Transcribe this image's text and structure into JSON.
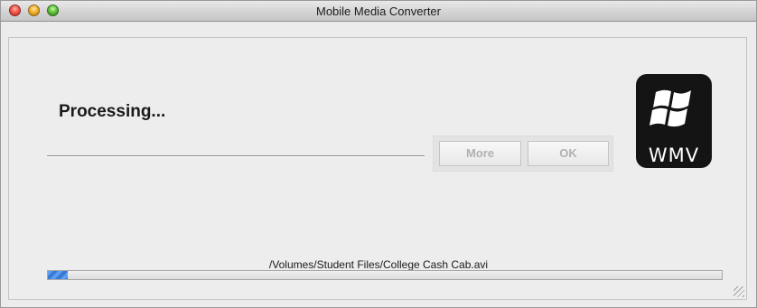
{
  "window": {
    "title": "Mobile Media Converter"
  },
  "main": {
    "status_heading": "Processing...",
    "buttons": {
      "more_label": "More",
      "ok_label": "OK"
    },
    "logo": {
      "text": "WMV",
      "icon": "windows-flag-icon"
    },
    "file_path": "/Volumes/Student Files/College Cash Cab.avi",
    "progress_fraction": 0.03
  },
  "colors": {
    "progress_fill": "#3a78d8",
    "logo_background": "#141414",
    "disabled_button_text": "#b1b1b1"
  }
}
